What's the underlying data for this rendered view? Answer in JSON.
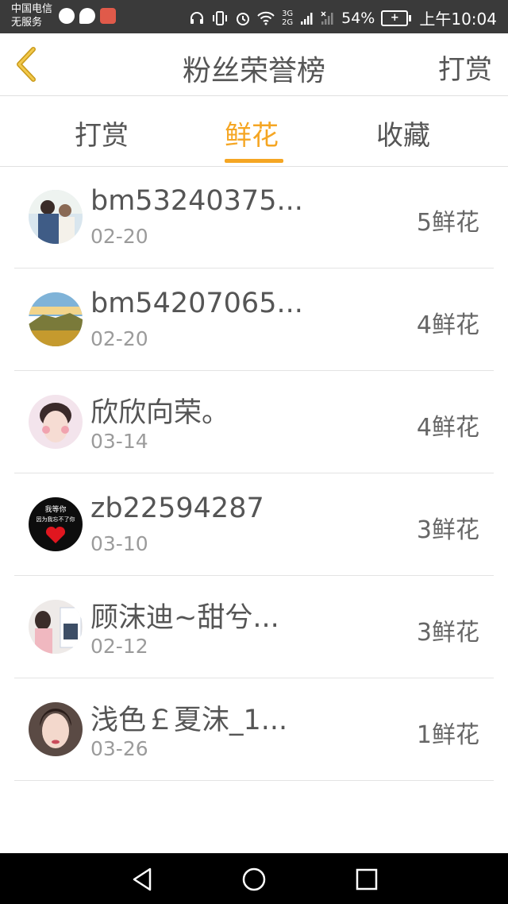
{
  "status_bar": {
    "carrier_line1": "中国电信",
    "carrier_line2": "无服务",
    "network": "3G 2G",
    "battery_pct": "54%",
    "time": "上午10:04"
  },
  "header": {
    "title": "粉丝荣誉榜",
    "action_label": "打赏"
  },
  "tabs": [
    {
      "label": "打赏",
      "active": false
    },
    {
      "label": "鲜花",
      "active": true
    },
    {
      "label": "收藏",
      "active": false
    }
  ],
  "rows": [
    {
      "name": "bm53240375...",
      "date": "02-20",
      "amount": "5鲜花"
    },
    {
      "name": "bm54207065...",
      "date": "02-20",
      "amount": "4鲜花"
    },
    {
      "name": "欣欣向荣。",
      "date": "03-14",
      "amount": "4鲜花"
    },
    {
      "name": "zb22594287",
      "date": "03-10",
      "amount": "3鲜花"
    },
    {
      "name": "顾沫迪~甜兮...",
      "date": "02-12",
      "amount": "3鲜花"
    },
    {
      "name": "浅色￡夏沫_1...",
      "date": "03-26",
      "amount": "1鲜花"
    }
  ],
  "avatar_text": {
    "line1": "我等你",
    "line2": "因为我忘不了你"
  },
  "colors": {
    "accent": "#f5a623",
    "status_bar": "#3a3a3a",
    "nav_bar": "#000000"
  }
}
